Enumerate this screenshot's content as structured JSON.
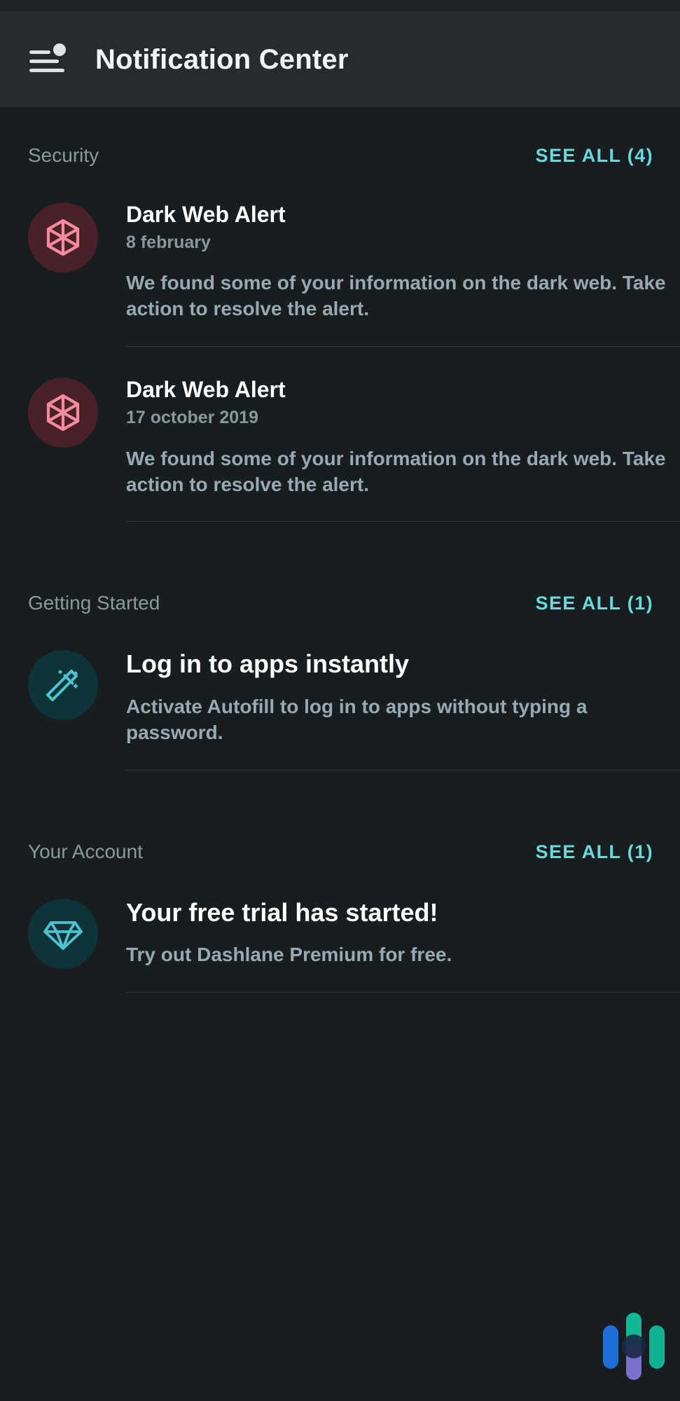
{
  "app": {
    "title": "Notification Center",
    "menu_icon": "hamburger-with-badge-icon",
    "brand_icon": "dashlane-logo"
  },
  "colors": {
    "background": "#181d20",
    "app_bar": "#252b2e",
    "status_bar": "#1e2326",
    "accent": "#6ad9de",
    "section_title": "#8d979c",
    "title_text": "#ffffff",
    "body_text": "#9aa8b0",
    "divider": "#2d3437",
    "alert_circle": "#4a2129",
    "alert_glyph": "#f48ba0",
    "info_circle": "#0e3338",
    "info_glyph": "#4fc3cd",
    "brand_blue": "#1e6fd9",
    "brand_green": "#12b894",
    "brand_purple": "#7b6fd0",
    "brand_teal": "#0fb394"
  },
  "sections": [
    {
      "id": "security",
      "title": "Security",
      "see_all_label": "SEE ALL (4)",
      "items": [
        {
          "icon": "dark-web-hexagon-icon",
          "icon_style": "red",
          "title": "Dark Web Alert",
          "title_size": "sm",
          "date": "8 february",
          "description": "We found some of your information on the dark web. Take action to resolve the alert."
        },
        {
          "icon": "dark-web-hexagon-icon",
          "icon_style": "red",
          "title": "Dark Web Alert",
          "title_size": "sm",
          "date": "17 october 2019",
          "description": "We found some of your information on the dark web. Take action to resolve the alert."
        }
      ]
    },
    {
      "id": "getting-started",
      "title": "Getting Started",
      "see_all_label": "SEE ALL (1)",
      "items": [
        {
          "icon": "magic-wand-icon",
          "icon_style": "teal",
          "title": "Log in to apps instantly",
          "title_size": "lg",
          "date": "",
          "description": "Activate Autofill to log in to apps without typing a password."
        }
      ]
    },
    {
      "id": "your-account",
      "title": "Your Account",
      "see_all_label": "SEE ALL (1)",
      "items": [
        {
          "icon": "diamond-icon",
          "icon_style": "teal",
          "title": "Your free trial has started!",
          "title_size": "lg",
          "date": "",
          "description": "Try out Dashlane Premium for free."
        }
      ]
    }
  ]
}
